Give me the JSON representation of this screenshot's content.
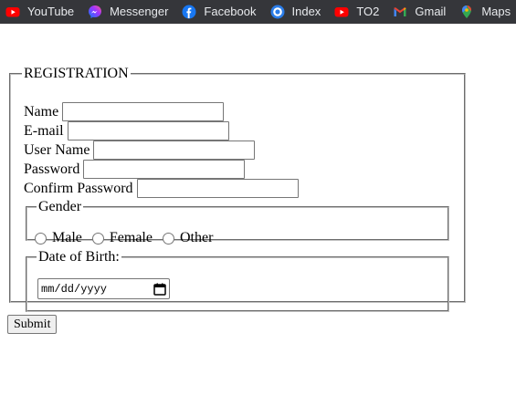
{
  "bookmarks": [
    {
      "label": "YouTube",
      "icon": "youtube-icon"
    },
    {
      "label": "Messenger",
      "icon": "messenger-icon"
    },
    {
      "label": "Facebook",
      "icon": "facebook-icon"
    },
    {
      "label": "Index",
      "icon": "index-icon"
    },
    {
      "label": "TO2",
      "icon": "youtube-icon"
    },
    {
      "label": "Gmail",
      "icon": "gmail-icon"
    },
    {
      "label": "Maps",
      "icon": "maps-icon"
    }
  ],
  "form": {
    "legend": "REGISTRATION",
    "fields": {
      "name": "Name",
      "email": "E-mail",
      "username": "User Name",
      "password": "Password",
      "confirm": "Confirm Password"
    },
    "gender": {
      "legend": "Gender",
      "options": [
        "Male",
        "Female",
        "Other"
      ]
    },
    "dob": {
      "legend": "Date of Birth:",
      "placeholder": "mm/dd/yyyy"
    },
    "submit": "Submit"
  },
  "colors": {
    "bookmarks_bg": "#35363a",
    "bookmarks_text": "#e8eaed",
    "youtube_red": "#ff0000",
    "facebook_blue": "#1877f2"
  }
}
